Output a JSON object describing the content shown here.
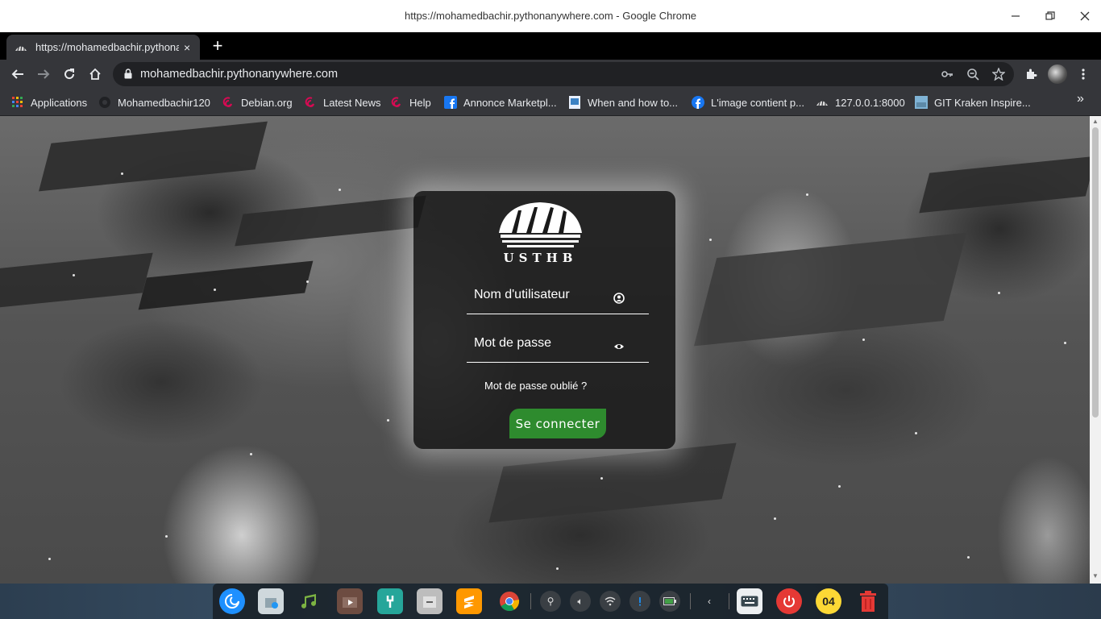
{
  "window": {
    "title": "https://mohamedbachir.pythonanywhere.com - Google Chrome",
    "minimize_icon": "minimize-icon",
    "restore_icon": "restore-icon",
    "close_icon": "close-icon"
  },
  "tab": {
    "title": "https://mohamedbachir.pythonanywhere.com",
    "close": "×",
    "new_tab": "+"
  },
  "toolbar": {
    "url": "mohamedbachir.pythonanywhere.com"
  },
  "bookmarks": [
    {
      "label": "Applications",
      "icon": "apps-grid-icon"
    },
    {
      "label": "Mohamedbachir120",
      "icon": "github-icon"
    },
    {
      "label": "Debian.org",
      "icon": "debian-icon"
    },
    {
      "label": "Latest News",
      "icon": "debian-icon"
    },
    {
      "label": "Help",
      "icon": "debian-icon"
    },
    {
      "label": "Annonce Marketpl...",
      "icon": "facebook-icon"
    },
    {
      "label": "When and how to...",
      "icon": "page-icon"
    },
    {
      "label": "L'image contient p...",
      "icon": "facebook-icon"
    },
    {
      "label": "127.0.0.1:8000",
      "icon": "ustbh-icon"
    },
    {
      "label": "GIT Kraken Inspire...",
      "icon": "image-icon"
    }
  ],
  "login": {
    "logo_text": "USTHB",
    "username_placeholder": "Nom d'utilisateur",
    "password_placeholder": "Mot de passe",
    "forgot": "Mot de passe oublié ?",
    "submit": "Se connecter"
  },
  "colors": {
    "chrome_dark": "#35363a",
    "omnibox": "#202124",
    "connect_button": "#2e8b2e"
  },
  "dock": {
    "clock": "04"
  }
}
